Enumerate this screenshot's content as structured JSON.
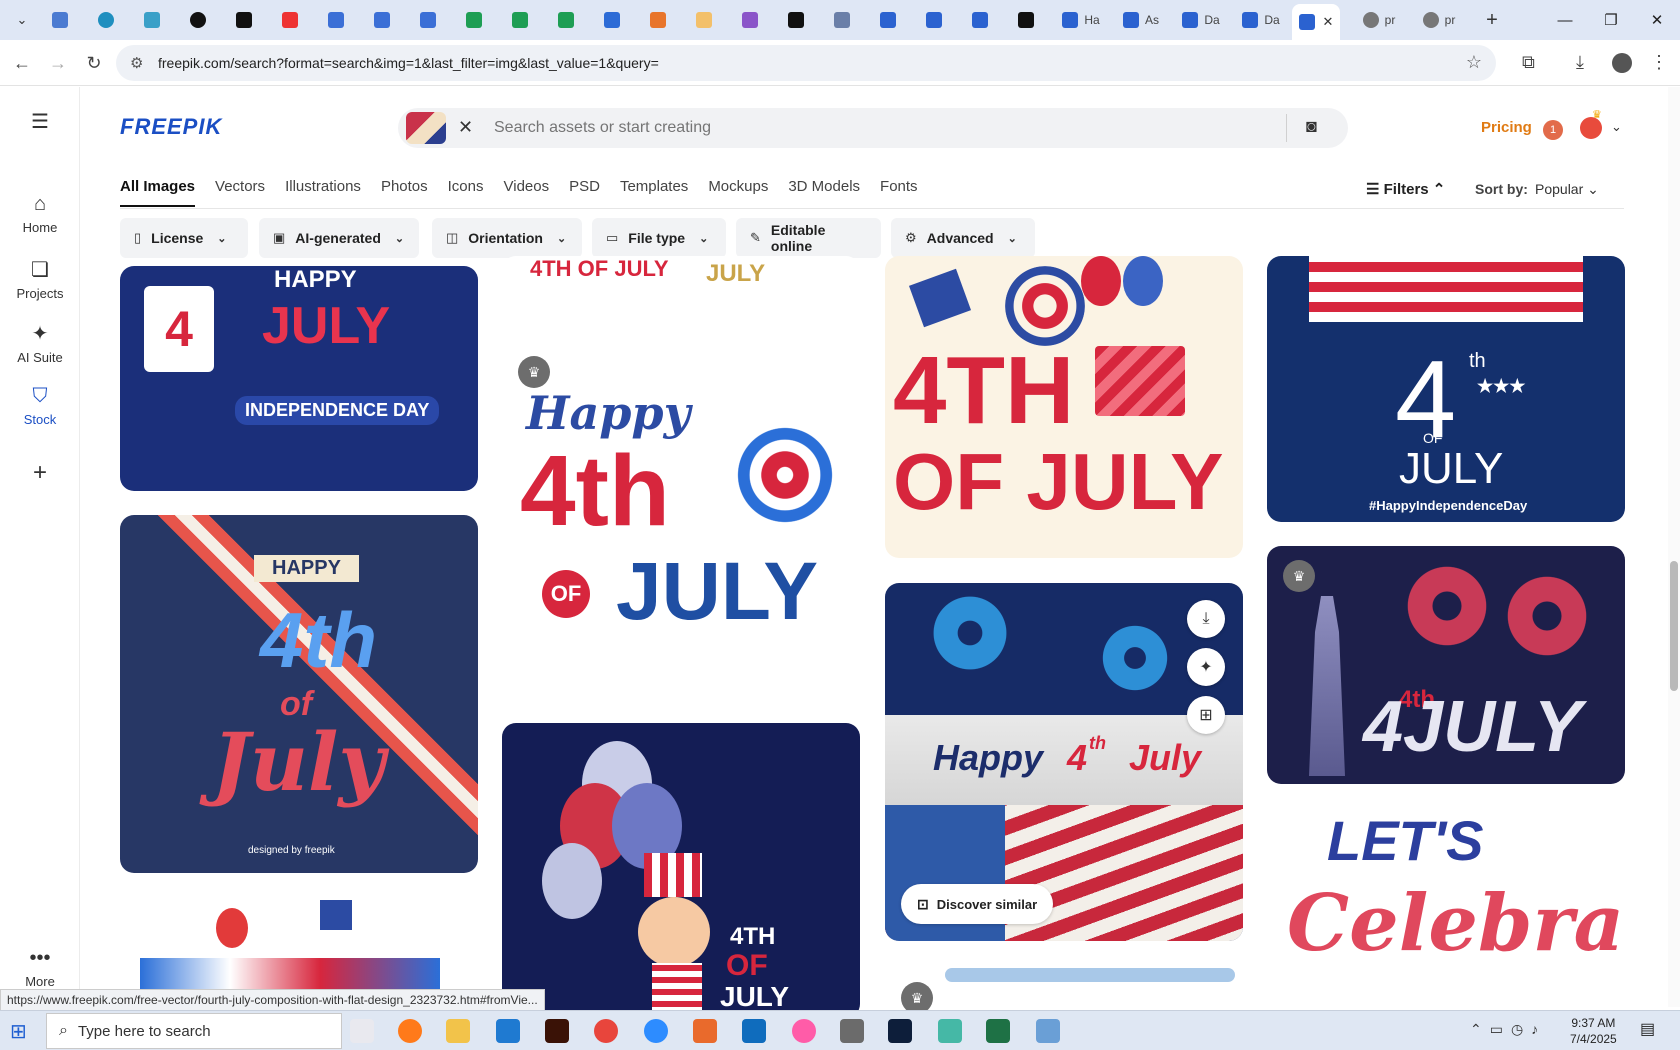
{
  "browser": {
    "tabs_visible_text": [
      "Ha",
      "As",
      "Da",
      "Da",
      "pr",
      "pr"
    ],
    "address_url": "freepik.com/search?format=search&img=1&last_filter=img&last_value=1&query=",
    "status_link": "https://www.freepik.com/free-vector/fourth-july-composition-with-flat-design_2323732.htm#fromVie..."
  },
  "rail": {
    "items": [
      {
        "label": "Home",
        "icon": "home-icon"
      },
      {
        "label": "Projects",
        "icon": "projects-icon"
      },
      {
        "label": "AI Suite",
        "icon": "sparkle-icon"
      },
      {
        "label": "Stock",
        "icon": "stock-icon"
      },
      {
        "label": "More",
        "icon": "more-icon"
      }
    ]
  },
  "header": {
    "logo": "FREEPIK",
    "search_placeholder": "Search assets or start creating",
    "pricing": "Pricing",
    "notification_count": "1"
  },
  "categories": [
    "All Images",
    "Vectors",
    "Illustrations",
    "Photos",
    "Icons",
    "Videos",
    "PSD",
    "Templates",
    "Mockups",
    "3D Models",
    "Fonts"
  ],
  "filters": {
    "filters_label": "Filters",
    "sort_label": "Sort by:",
    "sort_value": "Popular",
    "pills": [
      "License",
      "AI-generated",
      "Orientation",
      "File type",
      "Editable online",
      "Advanced"
    ]
  },
  "gallery": {
    "card1": {
      "l1": "HAPPY",
      "l2": "JULY",
      "l3": "INDEPENDENCE DAY",
      "cal": "4"
    },
    "card2_top": {
      "left": "4TH OF JULY",
      "right": "JULY"
    },
    "card3": {
      "l1": "Happy",
      "l2": "4th",
      "l3": "OF",
      "l4": "JULY"
    },
    "card4": {
      "l1": "4TH",
      "l2": "OF JULY"
    },
    "card5": {
      "l1": "4",
      "l2": "th",
      "l3": "OF",
      "l4": "JULY",
      "l5": "#HappyIndependenceDay"
    },
    "card6": {
      "l1": "HAPPY",
      "l2": "4th",
      "l3": "of",
      "l4": "July",
      "l5": "designed by freepik"
    },
    "card7": {
      "l1": "4TH",
      "l2": "OF",
      "l3": "JULY"
    },
    "card8": {
      "l1": "Happy",
      "l2": "4",
      "l3": "th",
      "l4": "July"
    },
    "card9": {
      "l1": "4th",
      "l2": "4JULY"
    },
    "card10": {
      "l1": "LET'S",
      "l2": "Celebrate"
    },
    "discover_label": "Discover similar"
  },
  "taskbar": {
    "search_text": "Type here to search",
    "time": "9:37 AM",
    "date": "7/4/2025"
  }
}
